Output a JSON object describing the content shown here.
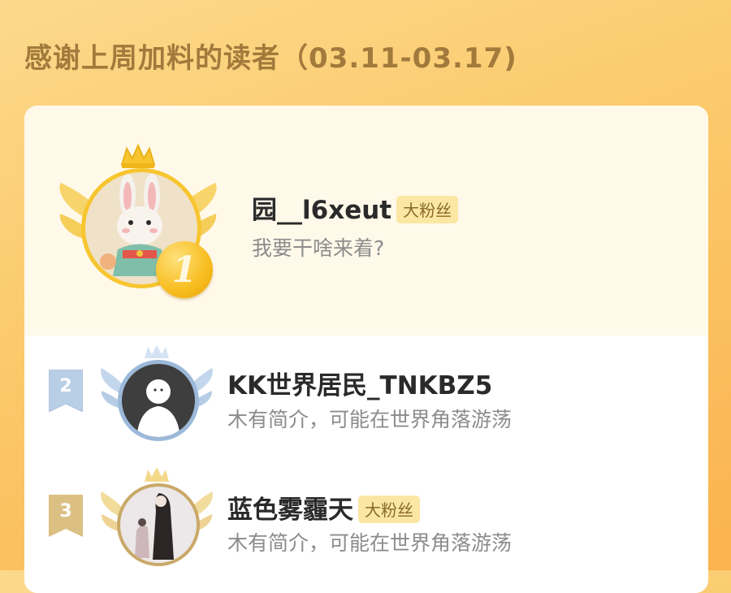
{
  "header": {
    "title": "感谢上周加料的读者（03.11-03.17)"
  },
  "readers": [
    {
      "rank": "1",
      "name": "园__l6xeut",
      "badge": "大粉丝",
      "bio": "我要干啥来着?"
    },
    {
      "rank": "2",
      "name": "KK世界居民_TNKBZ5",
      "badge": "",
      "bio": "木有简介，可能在世界角落游荡"
    },
    {
      "rank": "3",
      "name": "蓝色雾霾天",
      "badge": "大粉丝",
      "bio": "木有简介，可能在世界角落游荡"
    }
  ],
  "colors": {
    "gold": "#f7bd1f",
    "silver_blue": "#9cb9d9",
    "bronze": "#d8b46a",
    "fan_tag_bg": "#fbe7a3"
  },
  "icons": {
    "crown": "crown-icon",
    "wreath": "laurel-wreath-icon",
    "avatar_rabbit": "rabbit-avatar",
    "avatar_default": "default-person-avatar",
    "avatar_figure": "long-hair-figure-avatar"
  }
}
